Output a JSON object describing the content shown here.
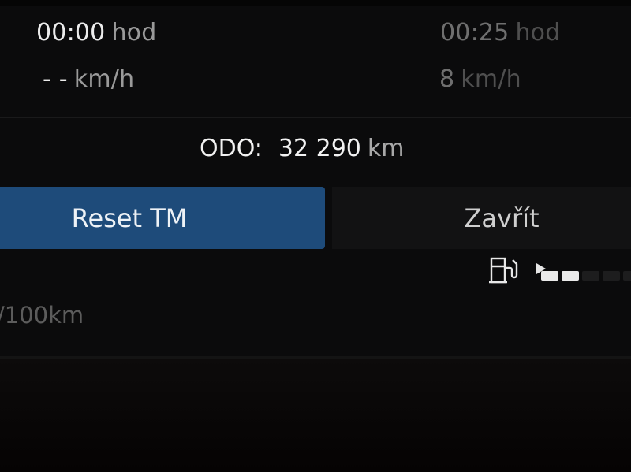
{
  "trip": {
    "left": {
      "time_value": "00:00",
      "time_unit": "hod",
      "speed_value": "- -",
      "speed_unit": "km/h"
    },
    "right": {
      "time_value": "00:25",
      "time_unit": "hod",
      "speed_value": "8",
      "speed_unit": "km/h"
    }
  },
  "odometer": {
    "label": "ODO:",
    "value": "32 290",
    "unit": "km"
  },
  "actions": {
    "reset_label": "Reset TM",
    "close_label": "Zavřít"
  },
  "fuel": {
    "icon": "fuel-pump-icon",
    "level_fraction": 0.4
  },
  "consumption": {
    "unit_text": "/100km"
  },
  "colors": {
    "accent_button": "#1e4b7a",
    "background": "#0b0b0c"
  }
}
